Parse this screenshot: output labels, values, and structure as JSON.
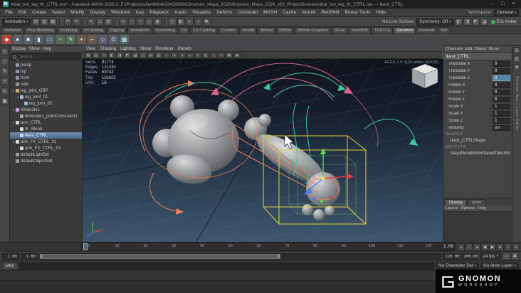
{
  "window": {
    "title": "tribal_bot_leg_IK_CTRL.ma* - Autodesk MAYA 2026.2: E:\\Projects\\clientWork\\GNOMON\\Gnomon_Maya_2026\\Gnomon_Maya_2026_v02_ProjectScenes\\tribal_bot_leg_IK_CTRL.ma --- Ikest_CTRL",
    "controls": [
      {
        "name": "minimize",
        "glyph": "–"
      },
      {
        "name": "maximize",
        "glyph": "□"
      },
      {
        "name": "close",
        "glyph": "×"
      }
    ]
  },
  "menu_bar": {
    "items": [
      "File",
      "Edit",
      "Create",
      "Select",
      "Modify",
      "Display",
      "Windows",
      "Key",
      "Playback",
      "Audio",
      "Visualize",
      "Deform",
      "Constrain",
      "MASH",
      "Cache",
      "Arnold",
      "RedShift",
      "Bonus Tools",
      "Help"
    ],
    "workspace_label": "Workspace:",
    "workspace_value": "General"
  },
  "status_line": {
    "menu_set": "Animation",
    "icon_groups": [
      [
        {
          "name": "new-scene-icon",
          "glyph": "▤"
        },
        {
          "name": "open-scene-icon",
          "glyph": "▥"
        },
        {
          "name": "save-scene-icon",
          "glyph": "▦"
        }
      ],
      [
        {
          "name": "undo-icon",
          "glyph": "↶"
        },
        {
          "name": "redo-icon",
          "glyph": "↷"
        }
      ],
      [
        {
          "name": "select-by-hierarchy-icon",
          "glyph": "↖"
        },
        {
          "name": "select-by-object-icon",
          "glyph": "□"
        },
        {
          "name": "select-by-component-icon",
          "glyph": "▧"
        }
      ],
      [
        {
          "name": "snap-to-grid-icon",
          "glyph": "#"
        },
        {
          "name": "snap-to-curve-icon",
          "glyph": "~"
        },
        {
          "name": "snap-to-point-icon",
          "glyph": "•"
        },
        {
          "name": "snap-to-plane-icon",
          "glyph": "◇"
        },
        {
          "name": "make-live-icon",
          "glyph": "◉"
        }
      ],
      [
        {
          "name": "construction-history-icon",
          "glyph": "◫"
        },
        {
          "name": "open-render-view-icon",
          "glyph": "◧"
        },
        {
          "name": "render-current-frame-icon",
          "glyph": "◐"
        },
        {
          "name": "ipr-render-icon",
          "glyph": "◑"
        },
        {
          "name": "render-settings-icon",
          "glyph": "✱"
        }
      ]
    ],
    "no_live_surface": "No Live Surface",
    "symmetry_label": "Symmetry: Off",
    "right_icons": [
      {
        "name": "toggle-outliner-panel-icon",
        "glyph": "◧"
      },
      {
        "name": "toggle-channel-box-icon",
        "glyph": "◨"
      },
      {
        "name": "toggle-attribute-editor-icon",
        "glyph": "◩"
      },
      {
        "name": "toggle-tool-settings-icon",
        "glyph": "◪"
      }
    ],
    "user": "Eric Keller"
  },
  "shelf": {
    "tabs": [
      "Surfaces",
      "Poly Modeling",
      "Sculpting",
      "UV Editing",
      "Rigging",
      "Animation",
      "Rendering",
      "FX",
      "FX Caching",
      "Custom",
      "Arnold",
      "Bifrost",
      "MASH",
      "Motion Graphics",
      "XGen",
      "RedShift",
      "TURTLE",
      "Gnomon",
      "General",
      "Net"
    ],
    "active_tab": "Gnomon",
    "icons": [
      {
        "name": "maya-logo-icon",
        "glyph": "◆",
        "color": "#b8413a"
      },
      {
        "name": "sphere-primitive-icon",
        "glyph": "●",
        "color": "#55606a"
      },
      {
        "name": "cube-primitive-icon",
        "glyph": "■",
        "color": "#55606a"
      },
      {
        "name": "cylinder-primitive-icon",
        "glyph": "▮",
        "color": "#55606a"
      },
      {
        "name": "plane-primitive-icon",
        "glyph": "▭",
        "color": "#55606a"
      },
      {
        "name": "curve-tool-icon",
        "glyph": "~",
        "color": "#566a58"
      },
      {
        "name": "pencil-curve-icon",
        "glyph": "✎",
        "color": "#566a58"
      },
      {
        "name": "joint-tool-icon",
        "glyph": "+",
        "color": "#6a5a49"
      },
      {
        "name": "ik-handle-tool-icon",
        "glyph": "⌐",
        "color": "#6a5a49"
      },
      {
        "name": "constraint-icon",
        "glyph": "◇",
        "color": "#5a5a6e"
      },
      {
        "name": "cluster-icon",
        "glyph": "©",
        "color": "#5a5a6e"
      },
      {
        "name": "lattice-icon",
        "glyph": "▦",
        "color": "#4f6a6a"
      }
    ]
  },
  "toolbox": {
    "tools": [
      {
        "name": "select-tool",
        "glyph": "↖"
      },
      {
        "name": "lasso-select-tool",
        "glyph": "◌"
      },
      {
        "name": "paint-select-tool",
        "glyph": "✎"
      },
      {
        "name": "move-tool",
        "glyph": "+"
      },
      {
        "name": "rotate-tool",
        "glyph": "↻"
      },
      {
        "name": "scale-tool",
        "glyph": "▣"
      }
    ]
  },
  "outliner": {
    "menus": [
      "Display",
      "Show",
      "Help"
    ],
    "search_placeholder": "Search...",
    "items": [
      {
        "label": "persp",
        "depth": 0,
        "type": "camera"
      },
      {
        "label": "top",
        "depth": 0,
        "type": "camera"
      },
      {
        "label": "front",
        "depth": 0,
        "type": "camera"
      },
      {
        "label": "side",
        "depth": 0,
        "type": "camera"
      },
      {
        "label": "leg_joint_GRP",
        "depth": 0,
        "type": "group",
        "arrow": true
      },
      {
        "label": "leg_joint_01",
        "depth": 1,
        "type": "joint",
        "arrow": true
      },
      {
        "label": "leg_joint_02",
        "depth": 2,
        "type": "joint"
      },
      {
        "label": "ikHandle1",
        "depth": 0,
        "type": "ikhandle",
        "arrow": true
      },
      {
        "label": "ikHandle1_pointConstraint1",
        "depth": 1,
        "type": "constraint"
      },
      {
        "label": "arm_CTRL",
        "depth": 0,
        "type": "curve",
        "arrow": true
      },
      {
        "label": "IK_Blend",
        "depth": 1,
        "type": "curve"
      },
      {
        "label": "Ikest_CTRL",
        "depth": 1,
        "type": "curve",
        "selected": true
      },
      {
        "label": "arm_FX_CTRL_01",
        "depth": 0,
        "type": "curve",
        "arrow": true
      },
      {
        "label": "arm_FX_CTRL_02",
        "depth": 1,
        "type": "curve"
      },
      {
        "label": "defaultLightSet",
        "depth": 0,
        "type": "set"
      },
      {
        "label": "defaultObjectSet",
        "depth": 0,
        "type": "set"
      }
    ]
  },
  "viewport": {
    "panel_menus": [
      "View",
      "Shading",
      "Lighting",
      "Show",
      "Renderer",
      "Panels"
    ],
    "toolbar_icons": [
      {
        "name": "camera-lock-icon",
        "glyph": "▦"
      },
      {
        "name": "camera-bookmark-icon",
        "glyph": "▧"
      },
      {
        "name": "grid-toggle-icon",
        "glyph": "#"
      },
      {
        "name": "film-gate-icon",
        "glyph": "◧"
      },
      {
        "name": "resolution-gate-icon",
        "glyph": "◨"
      },
      {
        "name": "gate-mask-icon",
        "glyph": "◩"
      },
      {
        "name": "field-chart-icon",
        "glyph": "◪"
      },
      {
        "name": "safe-action-icon",
        "glyph": "◫"
      },
      {
        "name": "safe-title-icon",
        "glyph": "▤"
      },
      {
        "name": "hud-toggle-icon",
        "glyph": "▥"
      },
      {
        "name": "wireframe-mode-icon",
        "glyph": "◐"
      },
      {
        "name": "shaded-mode-icon",
        "glyph": "●"
      },
      {
        "name": "textured-mode-icon",
        "glyph": "◑"
      },
      {
        "name": "use-all-lights-icon",
        "glyph": "◒"
      },
      {
        "name": "shadows-toggle-icon",
        "glyph": "◓"
      },
      {
        "name": "ssao-toggle-icon",
        "glyph": "◍"
      },
      {
        "name": "motion-blur-toggle-icon",
        "glyph": "◌"
      },
      {
        "name": "xray-toggle-icon",
        "glyph": "○"
      },
      {
        "name": "isolate-select-icon",
        "glyph": "▣"
      },
      {
        "name": "exposure-icon",
        "glyph": "◆"
      }
    ],
    "hud": {
      "rows": [
        [
          "Verts:",
          "81774"
        ],
        [
          "Edges:",
          "121281"
        ],
        [
          "Faces:",
          "59742"
        ],
        [
          "Tris:",
          "116622"
        ],
        [
          "UVs:",
          "16"
        ]
      ]
    },
    "color_mgmt": "ACES 1.0 SDR-video (sRGB)"
  },
  "channel_box": {
    "menus": [
      "Channels",
      "Edit",
      "Object",
      "Show"
    ],
    "object_name": "Ikest_CTRL",
    "attributes": [
      {
        "name": "Translate X",
        "value": "0"
      },
      {
        "name": "Translate Y",
        "value": "0"
      },
      {
        "name": "Translate Z",
        "value": "0",
        "selected": true
      },
      {
        "name": "Rotate X",
        "value": "0"
      },
      {
        "name": "Rotate Y",
        "value": "0"
      },
      {
        "name": "Rotate Z",
        "value": "0"
      },
      {
        "name": "Scale X",
        "value": "1"
      },
      {
        "name": "Scale Y",
        "value": "1"
      },
      {
        "name": "Scale Z",
        "value": "1"
      },
      {
        "name": "Visibility",
        "value": "on"
      }
    ],
    "shapes_header": "SHAPES",
    "shape_name": "Ikest_CTRLShape",
    "outputs_header": "OUTPUTS",
    "output_name": "MayaNodeEditorSavedTabsInfo"
  },
  "layer_editor": {
    "tabs": [
      "Display",
      "Anim"
    ],
    "menus": [
      "Layers",
      "Options",
      "Help"
    ]
  },
  "right_strip": {
    "icons": [
      {
        "name": "channel-box-tab-icon",
        "glyph": "▤"
      },
      {
        "name": "attribute-editor-tab-icon",
        "glyph": "▥"
      },
      {
        "name": "tool-settings-tab-icon",
        "glyph": "✱"
      }
    ],
    "label": "Channel Box / Layer Editor"
  },
  "time_slider": {
    "ticks": [
      "1",
      "10",
      "20",
      "30",
      "40",
      "50",
      "60",
      "70",
      "80",
      "90",
      "100",
      "110",
      "120"
    ]
  },
  "playback": {
    "current_frame": "1.00",
    "buttons": [
      {
        "name": "go-to-start-button",
        "glyph": "«"
      },
      {
        "name": "step-back-key-button",
        "glyph": "‹"
      },
      {
        "name": "step-back-frame-button",
        "glyph": "◂"
      },
      {
        "name": "play-backwards-button",
        "glyph": "◀"
      },
      {
        "name": "play-forwards-button",
        "glyph": "▶"
      },
      {
        "name": "step-forward-frame-button",
        "glyph": "▸"
      },
      {
        "name": "step-forward-key-button",
        "glyph": "›"
      },
      {
        "name": "go-to-end-button",
        "glyph": "»"
      }
    ]
  },
  "range_slider": {
    "anim_start": "1.00",
    "play_start": "1.00",
    "play_end": "120.00",
    "anim_end": "200.00",
    "fps": "24 fps",
    "icons": [
      {
        "name": "auto-keyframe-toggle",
        "glyph": "●",
        "color": "#cf4a4a"
      },
      {
        "name": "animation-preferences-button",
        "glyph": "✱"
      }
    ]
  },
  "command_line": {
    "mode_label": "MEL",
    "char_set": "No Character Set",
    "anim_layer": "No Anim Layer"
  },
  "help_line": {
    "text": ""
  },
  "watermark": {
    "line1": "GNOMON",
    "line2": "WORKSHOP"
  }
}
